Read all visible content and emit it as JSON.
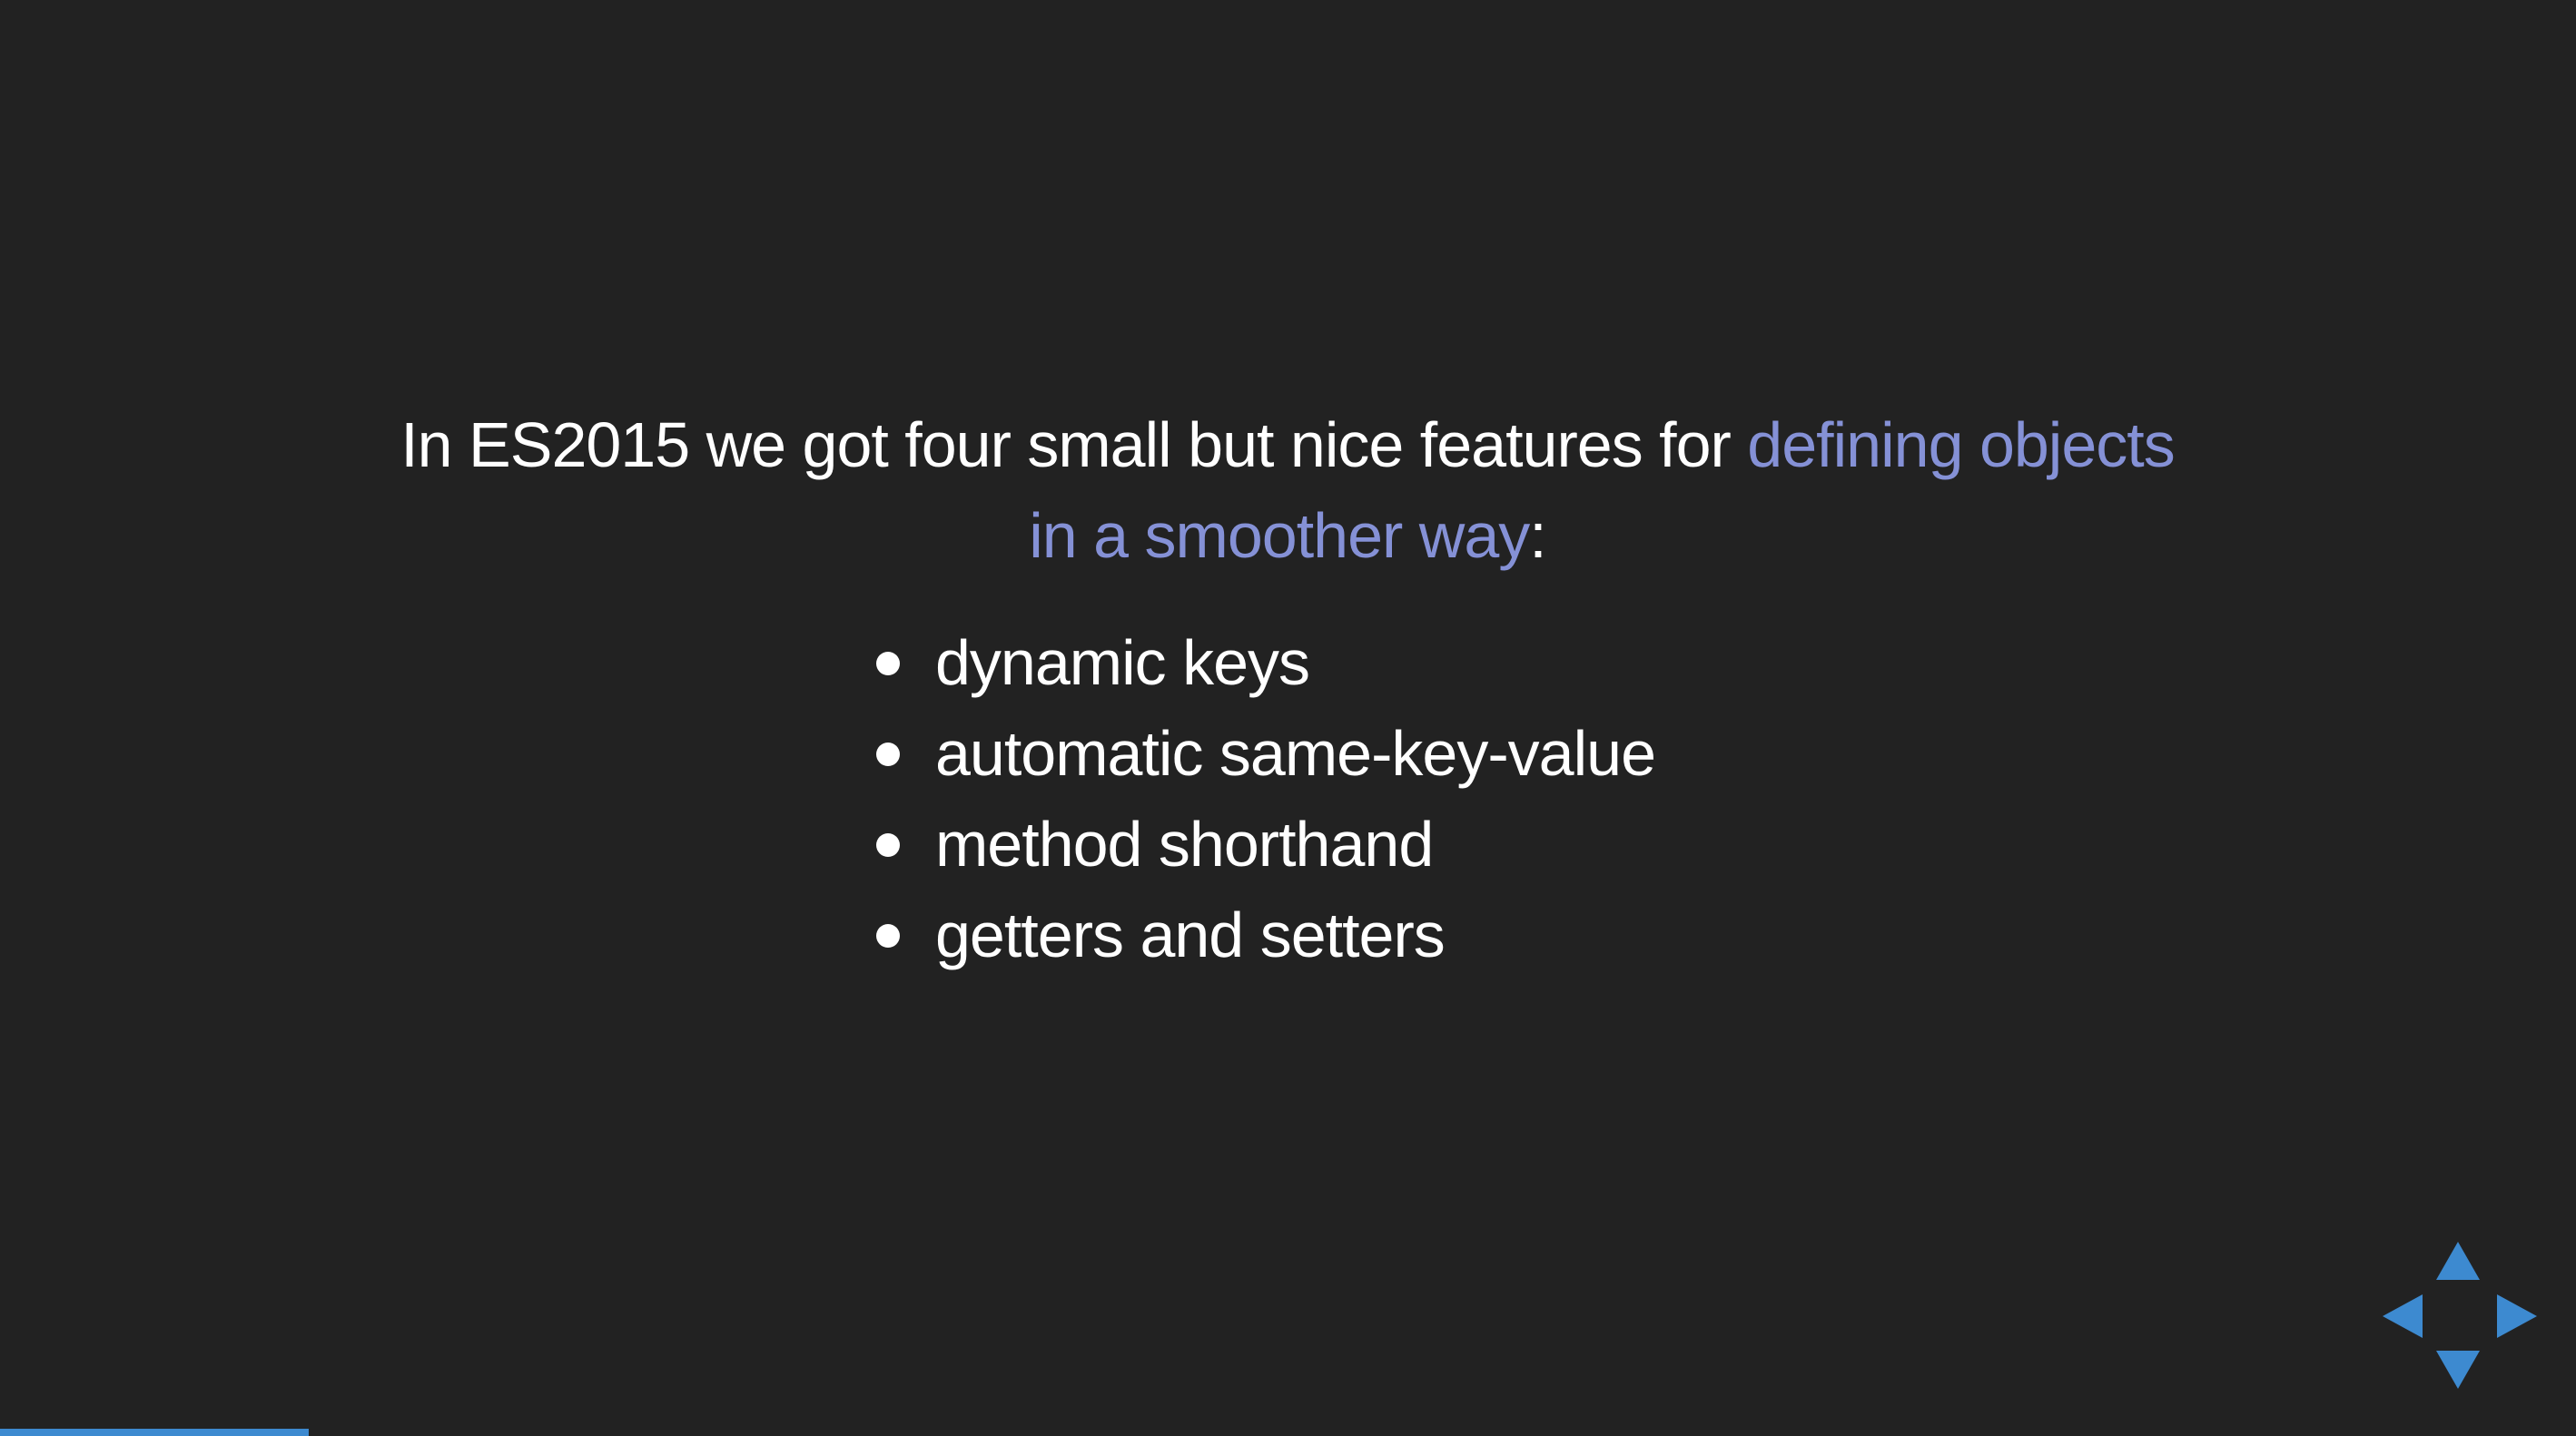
{
  "slide": {
    "intro_prefix": "In ES2015 we got four small but nice features for ",
    "intro_highlight": "defining objects in a smoother way",
    "intro_suffix": ":",
    "bullets": [
      "dynamic keys",
      "automatic same-key-value",
      "method shorthand",
      "getters and setters"
    ]
  },
  "navigation": {
    "controls": [
      "up-arrow-icon",
      "down-arrow-icon",
      "left-arrow-icon",
      "right-arrow-icon"
    ],
    "progress": 0.12
  },
  "colors": {
    "background": "#222222",
    "text": "#ffffff",
    "highlight": "#8591d6",
    "controls": "#3d8ad0"
  }
}
